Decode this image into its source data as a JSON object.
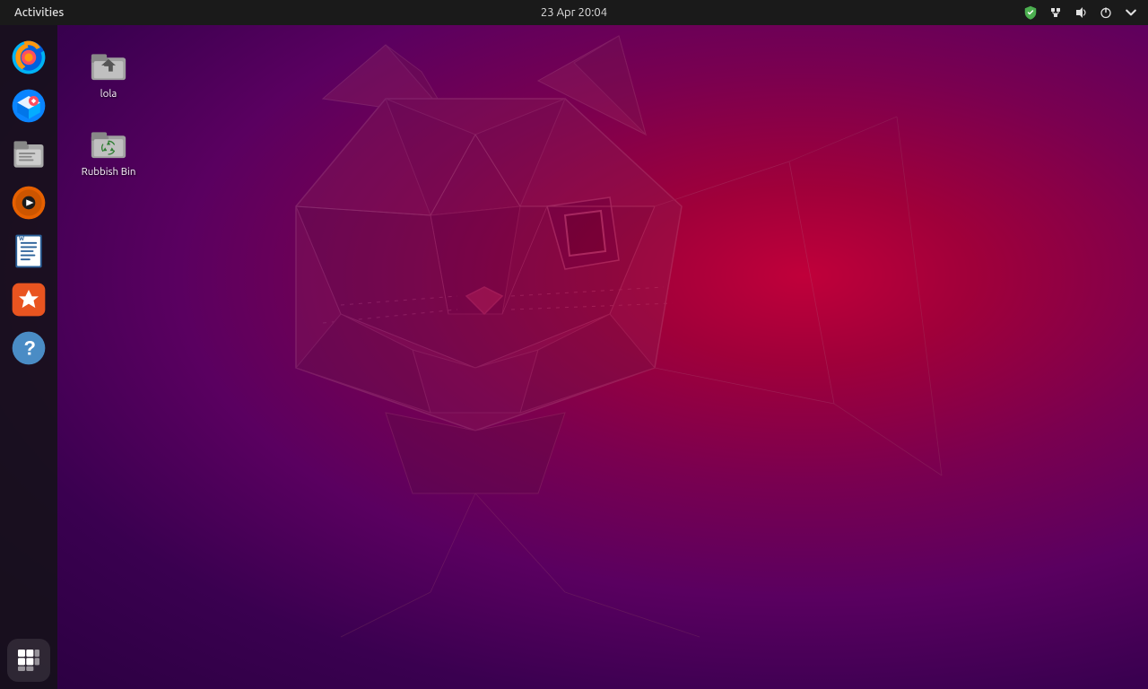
{
  "topbar": {
    "activities_label": "Activities",
    "datetime": "23 Apr  20:04"
  },
  "dock": {
    "items": [
      {
        "id": "firefox",
        "label": "Firefox Web Browser",
        "color": "#e66000"
      },
      {
        "id": "thunderbird",
        "label": "Thunderbird Mail",
        "color": "#00acdc"
      },
      {
        "id": "files",
        "label": "Files",
        "color": "#aaaaaa"
      },
      {
        "id": "rhythmbox",
        "label": "Rhythmbox",
        "color": "#e66000"
      },
      {
        "id": "writer",
        "label": "LibreOffice Writer",
        "color": "#2a6099"
      },
      {
        "id": "appstore",
        "label": "Ubuntu Software",
        "color": "#e95420"
      },
      {
        "id": "help",
        "label": "Help",
        "color": "#4a8cc5"
      }
    ],
    "show_apps_label": "Show Applications"
  },
  "desktop": {
    "icons": [
      {
        "id": "home",
        "label": "lola",
        "type": "home"
      },
      {
        "id": "rubbish",
        "label": "Rubbish Bin",
        "type": "trash"
      }
    ]
  },
  "status_icons": {
    "shield": "shield",
    "network": "network",
    "sound": "sound",
    "power": "power",
    "arrow": "arrow-down"
  }
}
